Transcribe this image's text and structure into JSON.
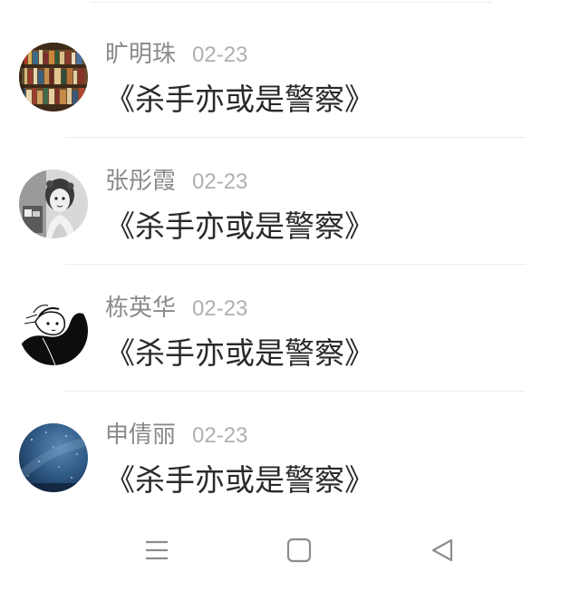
{
  "comments": [
    {
      "username": "旷明珠",
      "date": "02-23",
      "content": "《杀手亦或是警察》",
      "avatar": "bookshelf-avatar"
    },
    {
      "username": "张彤霞",
      "date": "02-23",
      "content": "《杀手亦或是警察》",
      "avatar": "girl-portrait-avatar"
    },
    {
      "username": "栋英华",
      "date": "02-23",
      "content": "《杀手亦或是警察》",
      "avatar": "sketch-portrait-avatar"
    },
    {
      "username": "申倩丽",
      "date": "02-23",
      "content": "《杀手亦或是警察》",
      "avatar": "night-sky-avatar"
    }
  ],
  "navbar": {
    "menu_icon": "menu-icon",
    "home_icon": "home-square-icon",
    "back_icon": "back-triangle-icon"
  },
  "colors": {
    "username": "#8a8a8a",
    "date": "#b0b0b0",
    "content": "#2a2a2a",
    "divider": "#ececec",
    "nav_icon": "#8c8c8c"
  }
}
